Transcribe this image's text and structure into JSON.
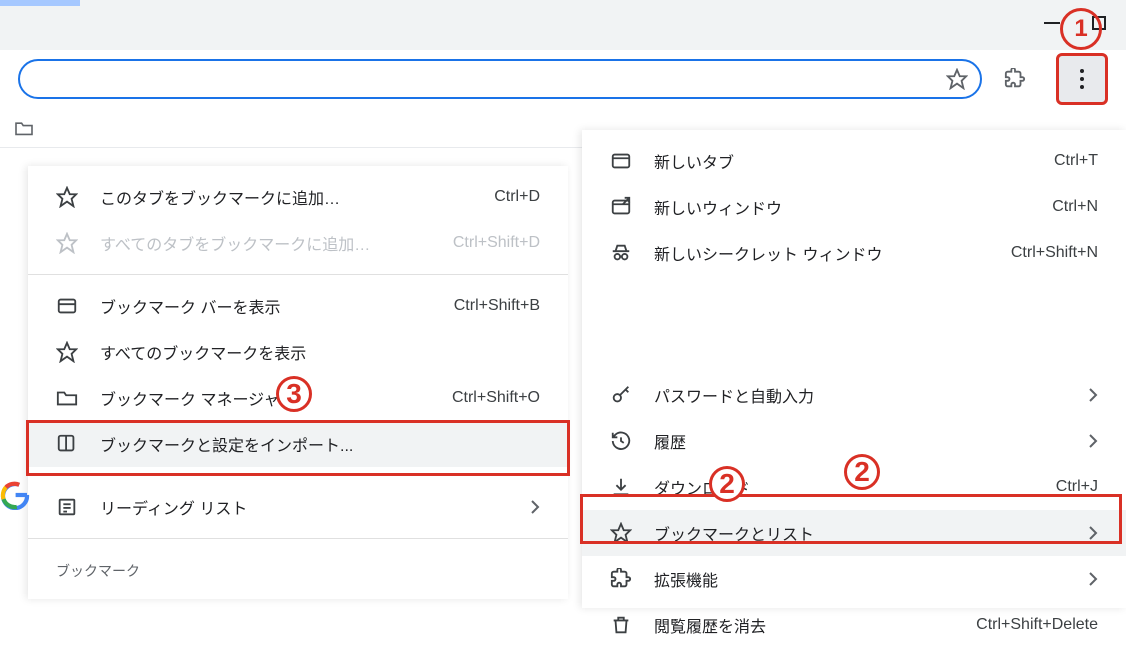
{
  "annotations": {
    "one": "1",
    "two": "2",
    "three": "3"
  },
  "mainMenu": {
    "newTab": {
      "label": "新しいタブ",
      "shortcut": "Ctrl+T"
    },
    "newWindow": {
      "label": "新しいウィンドウ",
      "shortcut": "Ctrl+N"
    },
    "incognito": {
      "label": "新しいシークレット ウィンドウ",
      "shortcut": "Ctrl+Shift+N"
    },
    "passwords": {
      "label": "パスワードと自動入力"
    },
    "history": {
      "label": "履歴"
    },
    "downloads": {
      "label": "ダウンロード",
      "shortcut": "Ctrl+J"
    },
    "bookmarks": {
      "label": "ブックマークとリスト"
    },
    "extensions": {
      "label": "拡張機能"
    },
    "clearData": {
      "label": "閲覧履歴を消去",
      "shortcut": "Ctrl+Shift+Delete"
    }
  },
  "subMenu": {
    "bookmarkTab": {
      "label": "このタブをブックマークに追加…",
      "shortcut": "Ctrl+D"
    },
    "bookmarkAll": {
      "label": "すべてのタブをブックマークに追加…",
      "shortcut": "Ctrl+Shift+D"
    },
    "showBar": {
      "label": "ブックマーク バーを表示",
      "shortcut": "Ctrl+Shift+B"
    },
    "showAll": {
      "label": "すべてのブックマークを表示"
    },
    "manager": {
      "label": "ブックマーク マネージャ",
      "shortcut": "Ctrl+Shift+O"
    },
    "import": {
      "label": "ブックマークと設定をインポート..."
    },
    "readingList": {
      "label": "リーディング リスト"
    },
    "heading": "ブックマーク"
  }
}
